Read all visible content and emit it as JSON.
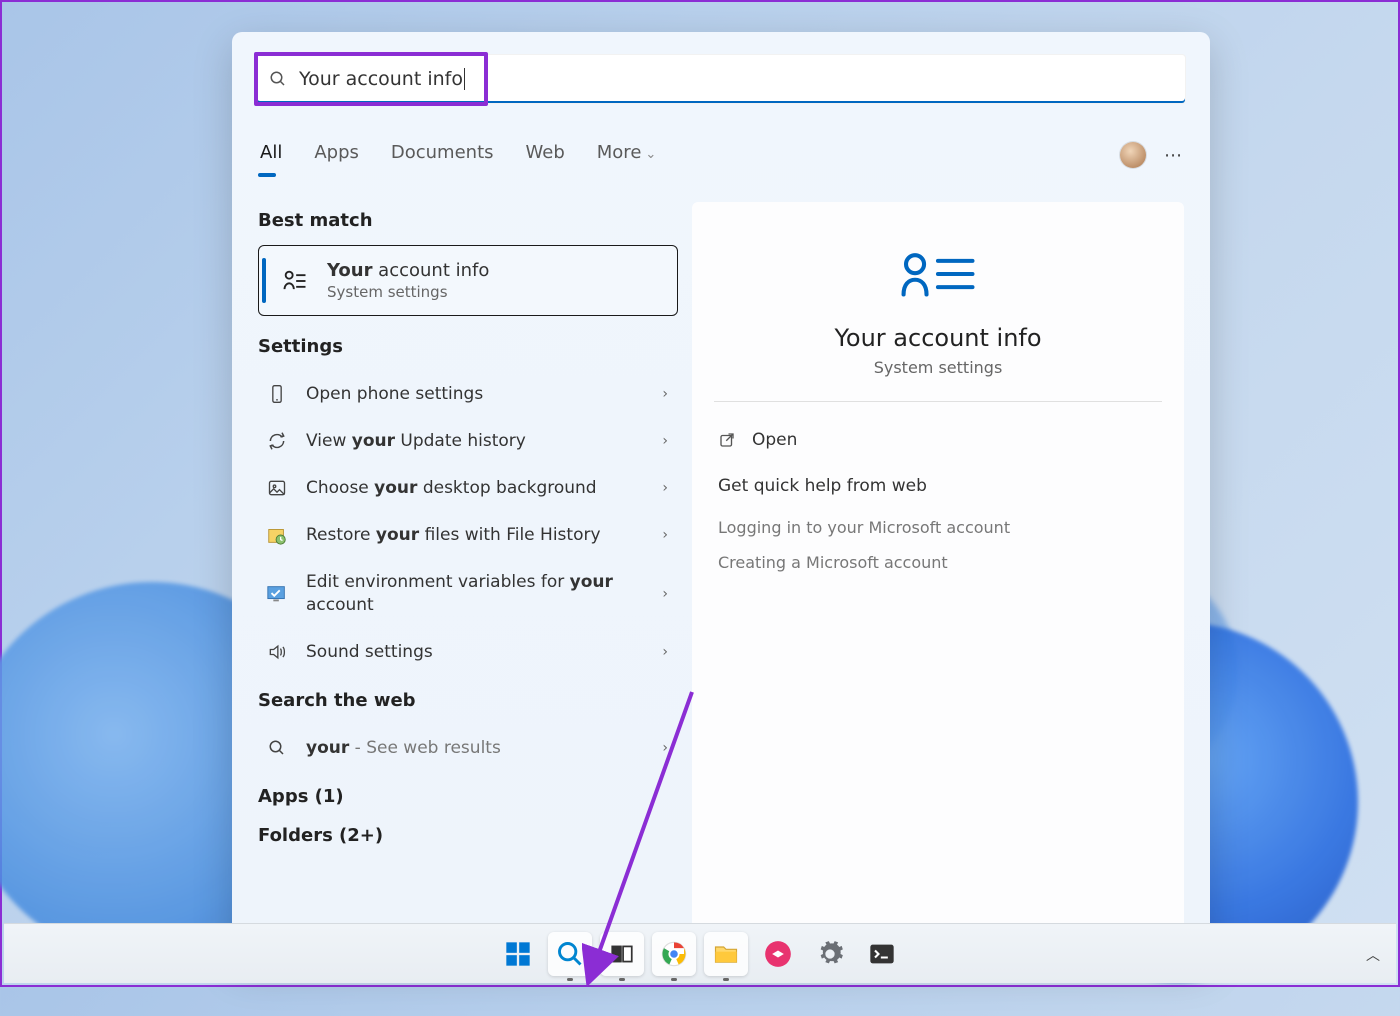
{
  "search": {
    "query": "Your account info"
  },
  "tabs": [
    "All",
    "Apps",
    "Documents",
    "Web",
    "More"
  ],
  "sections": {
    "best_match": "Best match",
    "settings": "Settings",
    "search_web": "Search the web",
    "apps": "Apps (1)",
    "folders": "Folders (2+)"
  },
  "best_match_item": {
    "title_bold": "Your",
    "title_rest": " account info",
    "subtitle": "System settings"
  },
  "settings_items": [
    {
      "pre": "Open phone settings",
      "bold": "",
      "post": ""
    },
    {
      "pre": "View ",
      "bold": "your",
      "post": " Update history"
    },
    {
      "pre": "Choose ",
      "bold": "your",
      "post": " desktop background"
    },
    {
      "pre": "Restore ",
      "bold": "your",
      "post": " files with File History"
    },
    {
      "pre": "Edit environment variables for ",
      "bold": "your",
      "post": " account"
    },
    {
      "pre": "Sound settings",
      "bold": "",
      "post": ""
    }
  ],
  "web_item": {
    "bold": "your",
    "muted": " - See web results"
  },
  "preview": {
    "title": "Your account info",
    "subtitle": "System settings",
    "open": "Open",
    "help_head": "Get quick help from web",
    "help_links": [
      "Logging in to your Microsoft account",
      "Creating a Microsoft account"
    ]
  }
}
